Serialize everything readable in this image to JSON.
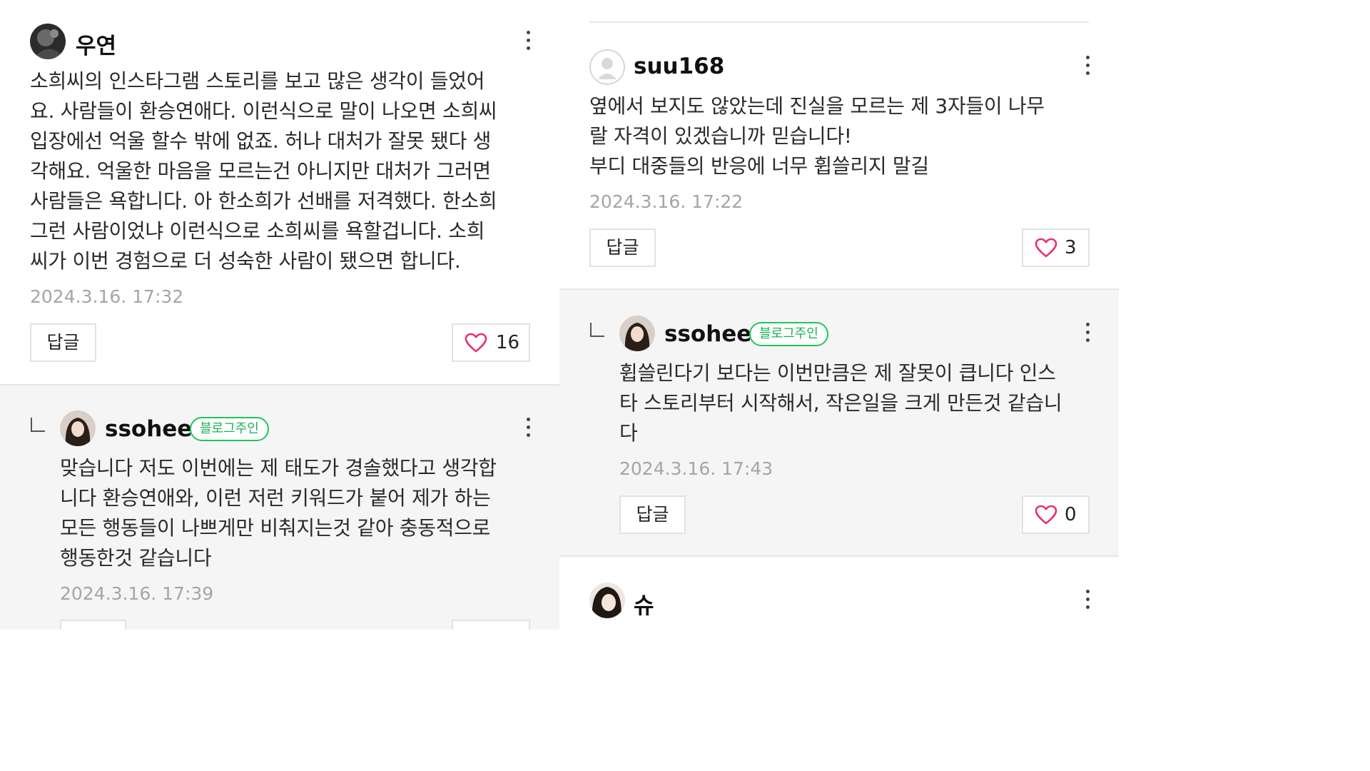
{
  "comments": {
    "woo": {
      "author": "우연",
      "text": "소희씨의 인스타그램 스토리를 보고 많은 생각이 들었어\n요. 사람들이 환승연애다. 이런식으로 말이 나오면 소희씨\n입장에선 억울 할수 밖에 없죠. 허나 대처가 잘못 됐다 생\n각해요. 억울한 마음을 모르는건 아니지만 대처가 그러면\n사람들은 욕합니다. 아 한소희가 선배를 저격했다. 한소희\n그런 사람이었냐 이런식으로 소희씨를 욕할겁니다. 소희\n씨가 이번 경험으로 더 성숙한 사람이 됐으면 합니다.",
      "date": "2024.3.16. 17:32",
      "reply_label": "답글",
      "likes": "16"
    },
    "ssohee_1": {
      "author": "ssohee",
      "badge": "블로그주인",
      "text": "맞습니다 저도 이번에는 제 태도가 경솔했다고 생각합\n니다 환승연애와, 이런 저런 키워드가 붙어 제가 하는\n모든 행동들이 나쁘게만 비춰지는것 같아 충동적으로\n행동한것 같습니다",
      "date": "2024.3.16. 17:39"
    },
    "suu168": {
      "author": "suu168",
      "text": "옆에서 보지도 않았는데 진실을 모르는 제 3자들이 나무\n랄 자격이 있겠습니까 믿습니다!\n부디 대중들의 반응에 너무 휩쓸리지 말길",
      "date": "2024.3.16. 17:22",
      "reply_label": "답글",
      "likes": "3"
    },
    "ssohee_2": {
      "author": "ssohee",
      "badge": "블로그주인",
      "text": "휩쓸린다기 보다는 이번만큼은 제 잘못이 큽니다 인스\n타 스토리부터 시작해서, 작은일을 크게 만든것 같습니\n다",
      "date": "2024.3.16. 17:43",
      "reply_label": "답글",
      "likes": "0"
    },
    "shu": {
      "author": "슈"
    }
  },
  "colors": {
    "badge_green": "#21c45b",
    "heart_pink": "#e8326e",
    "date_gray": "#a5a5a5",
    "reply_bg": "#f5f5f5"
  },
  "icons": {
    "like": "heart-outline-icon",
    "more": "vertical-dots-icon",
    "reply_indent": "reply-corner-icon"
  }
}
